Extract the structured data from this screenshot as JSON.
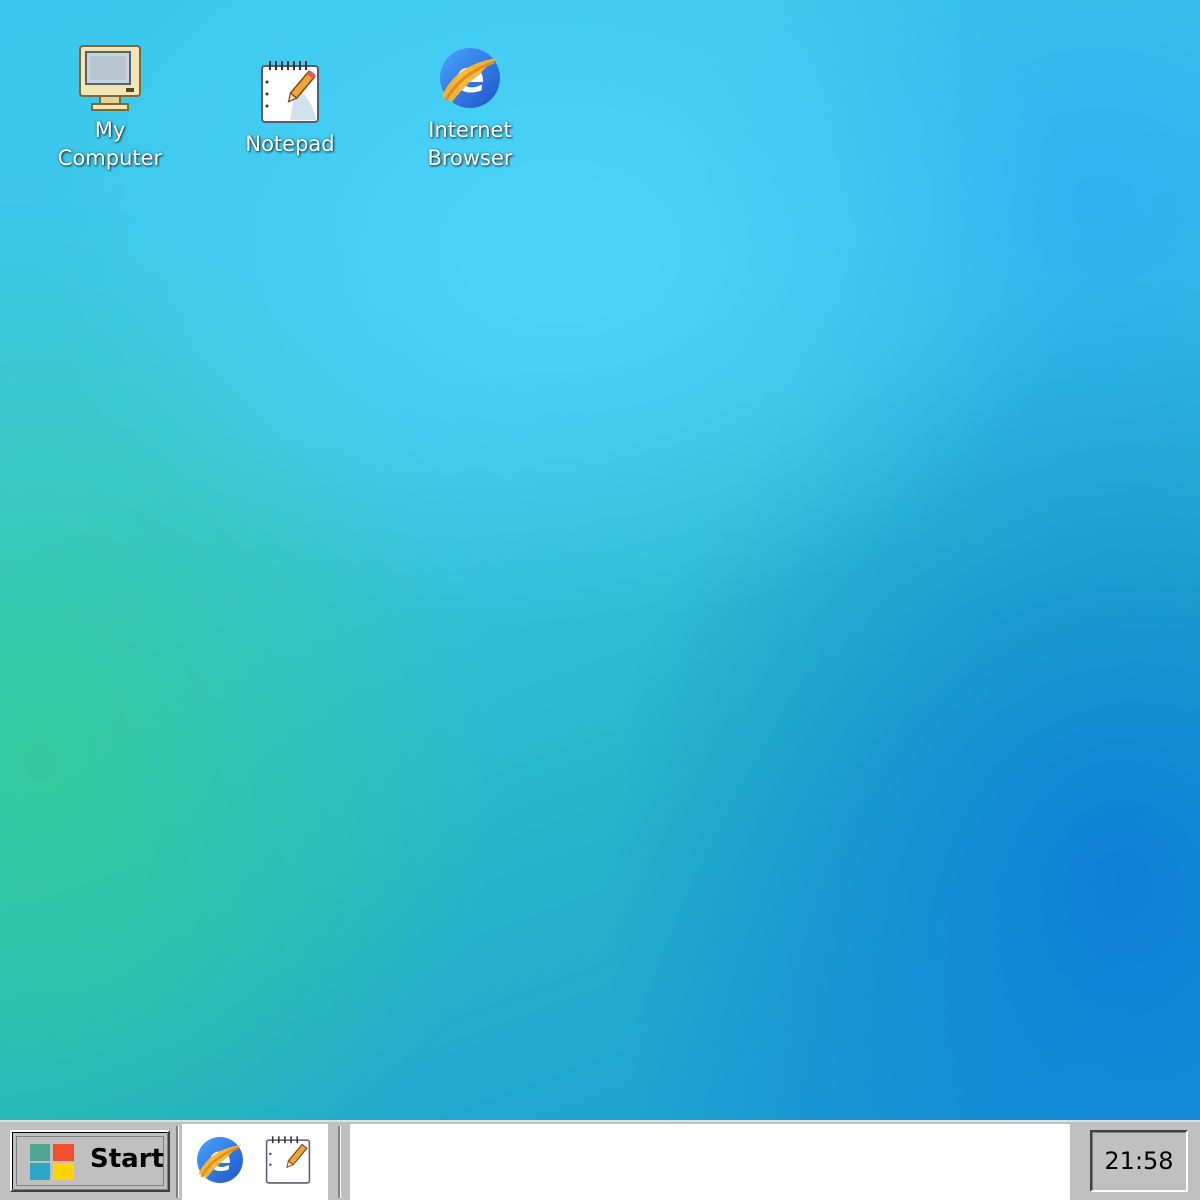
{
  "desktop": {
    "icons": [
      {
        "id": "my-computer",
        "label": "My\nComputer",
        "icon": "computer-icon"
      },
      {
        "id": "notepad",
        "label": "Notepad",
        "icon": "notepad-icon"
      },
      {
        "id": "internet-browser",
        "label": "Internet\nBrowser",
        "icon": "browser-icon"
      }
    ]
  },
  "taskbar": {
    "start_label": "Start",
    "start_icon": "windows-logo-icon",
    "quick_launch": [
      {
        "icon": "browser-icon"
      },
      {
        "icon": "notepad-icon"
      }
    ],
    "clock": "21:58"
  },
  "colors": {
    "taskbar": "#c0c0c0",
    "desktop_cyan": "#3cc8ee",
    "desktop_blue": "#1a98d6",
    "desktop_green": "#32cd91"
  }
}
